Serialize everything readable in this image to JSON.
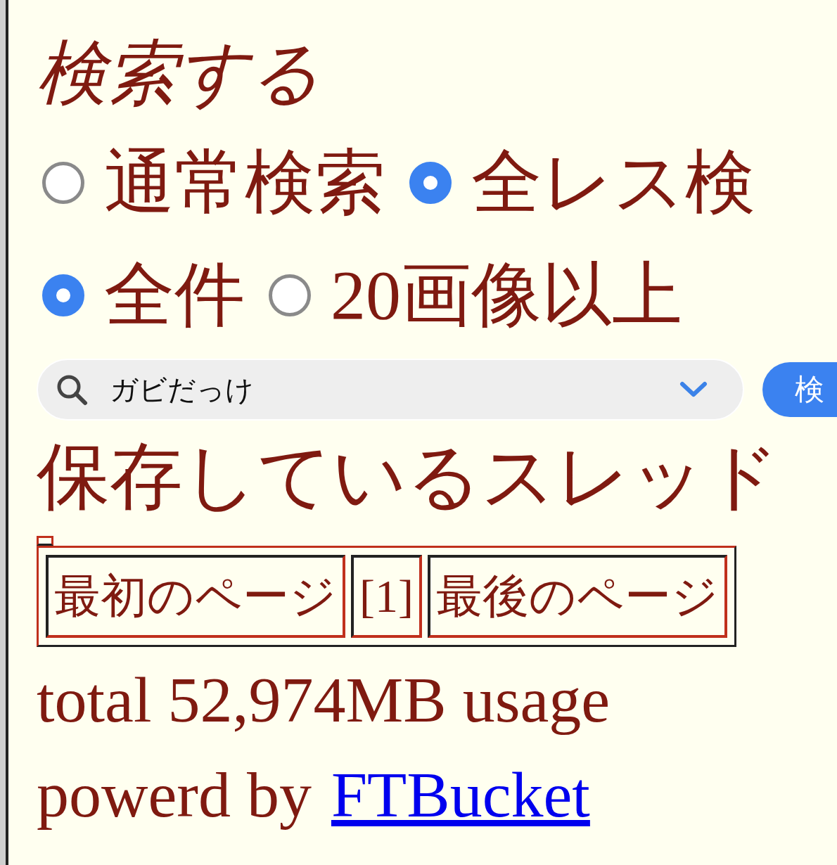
{
  "title": "検索する",
  "search_modes": [
    {
      "label": "通常検索",
      "selected": false
    },
    {
      "label": "全レス検",
      "selected": true
    }
  ],
  "filters": [
    {
      "label": "全件",
      "selected": true
    },
    {
      "label": "20画像以上",
      "selected": false
    }
  ],
  "search": {
    "value": "ガビだっけ",
    "button": "検"
  },
  "heading": "保存しているスレッド",
  "pager": [
    "最初のページ",
    "[1]",
    "最後のページ"
  ],
  "usage": "total 52,974MB usage",
  "footer": {
    "text": "powerd by",
    "link": "FTBucket"
  }
}
